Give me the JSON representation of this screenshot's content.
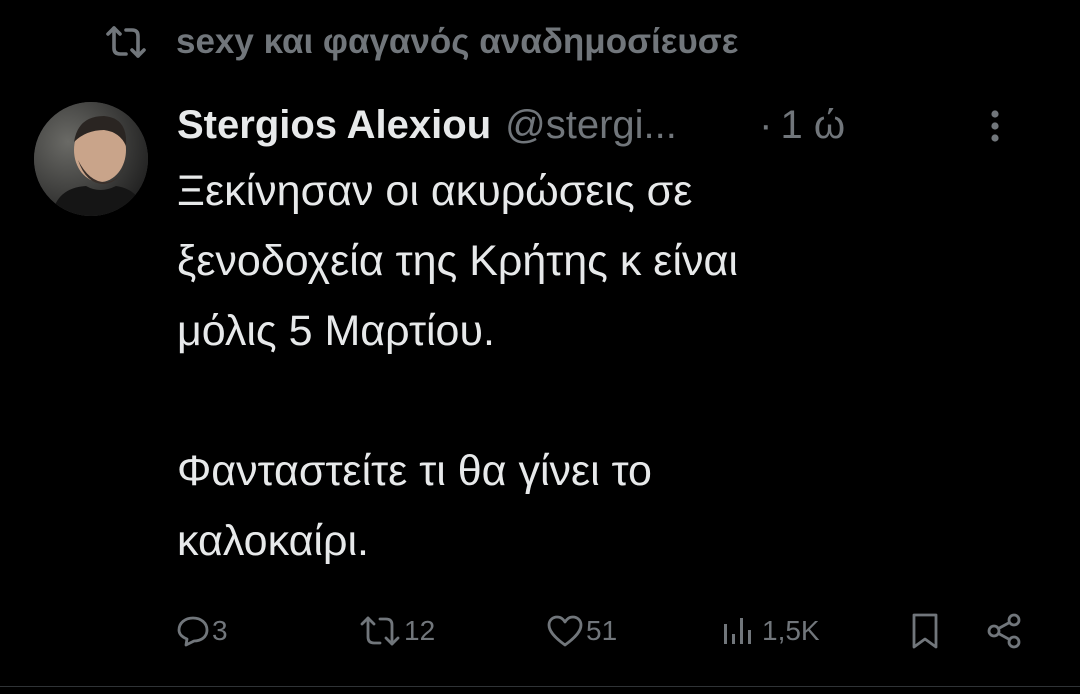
{
  "repost_banner": {
    "text": "sexy και φαγανός αναδημοσίευσε",
    "icon": "repost-icon"
  },
  "tweet": {
    "author_name": "Stergios Alexiou",
    "author_handle": "@stergi...",
    "separator": "·",
    "timestamp": "1 ώ",
    "text_lines_p1": [
      "Ξεκίνησαν οι ακυρώσεις σε",
      "ξενοδοχεία της Κρήτης κ είναι",
      "μόλις 5 Μαρτίου."
    ],
    "text_lines_p2": [
      "Φανταστείτε τι θα γίνει το",
      "καλοκαίρι."
    ]
  },
  "actions": {
    "reply_count": "3",
    "repost_count": "12",
    "like_count": "51",
    "views_count": "1,5K"
  },
  "colors": {
    "background": "#000000",
    "text_primary": "#e7e9ea",
    "text_secondary": "#71767b"
  }
}
